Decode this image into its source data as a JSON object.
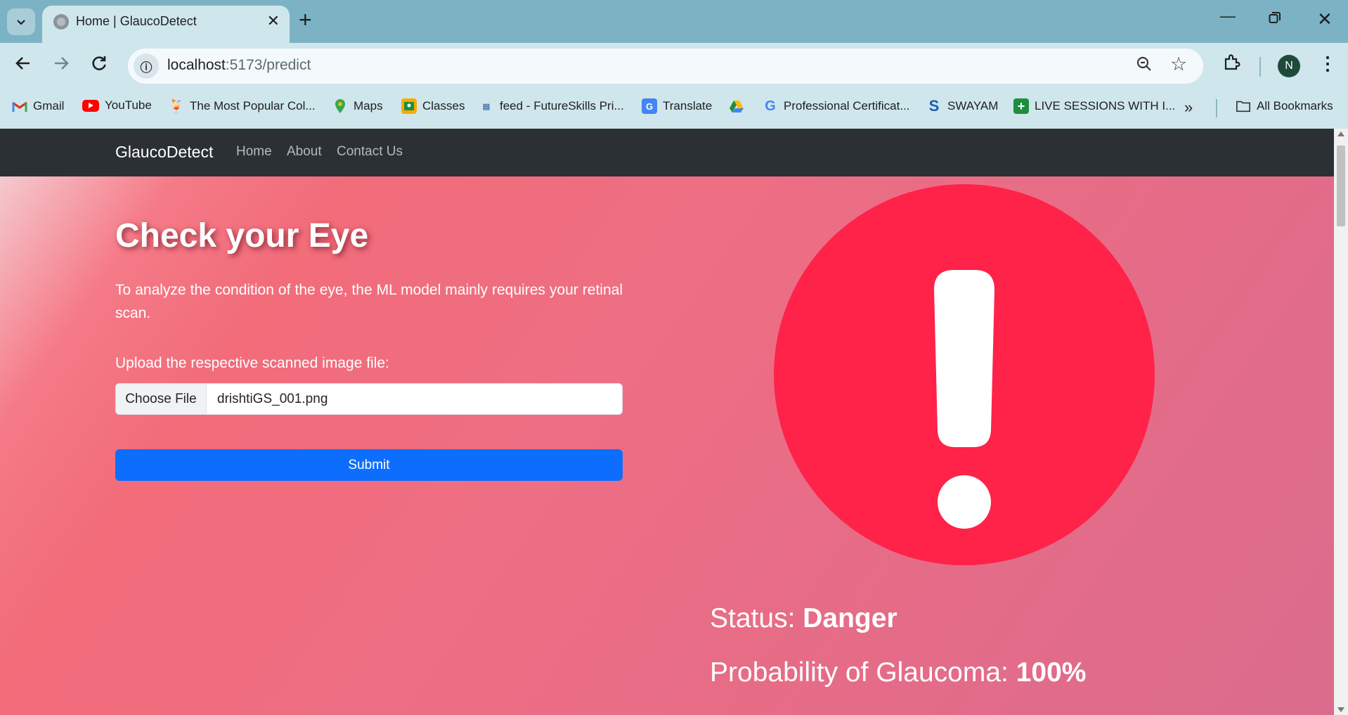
{
  "browser": {
    "tab_title": "Home | GlaucoDetect",
    "url_host": "localhost",
    "url_path": ":5173/predict",
    "profile_initial": "N",
    "bookmarks": [
      {
        "label": "Gmail",
        "icon": "gmail-icon"
      },
      {
        "label": "YouTube",
        "icon": "youtube-icon"
      },
      {
        "label": "The Most Popular Col...",
        "icon": "cup-icon"
      },
      {
        "label": "Maps",
        "icon": "maps-icon"
      },
      {
        "label": "Classes",
        "icon": "classroom-icon"
      },
      {
        "label": "feed - FutureSkills Pri...",
        "icon": "futureskills-icon"
      },
      {
        "label": "Translate",
        "icon": "translate-icon"
      },
      {
        "label": "",
        "icon": "drive-icon"
      },
      {
        "label": "Professional Certificat...",
        "icon": "google-icon"
      },
      {
        "label": "SWAYAM",
        "icon": "swayam-icon"
      },
      {
        "label": "LIVE SESSIONS WITH I...",
        "icon": "sheets-icon"
      }
    ],
    "all_bookmarks": "All Bookmarks"
  },
  "navbar": {
    "brand": "GlaucoDetect",
    "links": [
      "Home",
      "About",
      "Contact Us"
    ]
  },
  "main": {
    "title": "Check your Eye",
    "intro": "To analyze the condition of the eye, the ML model mainly requires your retinal scan.",
    "upload_label": "Upload the respective scanned image file:",
    "file_button": "Choose File",
    "file_name": "drishtiGS_001.png",
    "submit_label": "Submit"
  },
  "result": {
    "status_label": "Status:",
    "status_value": "Danger",
    "prob_label": "Probability of Glaucoma:",
    "prob_value": "100%",
    "alert_color": "#ff2249"
  }
}
